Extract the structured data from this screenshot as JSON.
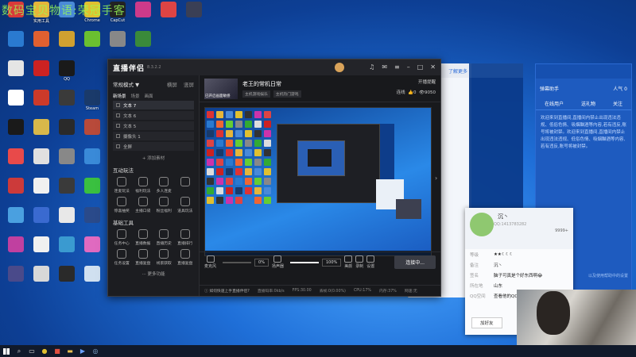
{
  "watermark": "数码宝贝物语:荣冠手客",
  "desktop_icons": [
    {
      "label": "",
      "color": "#d83a3a",
      "col": 0,
      "row": 0
    },
    {
      "label": "实用工具",
      "color": "#e5b53a",
      "col": 1,
      "row": 0
    },
    {
      "label": "",
      "color": "#4a8ad8",
      "col": 2,
      "row": 0
    },
    {
      "label": "Chrome",
      "color": "#e0c030",
      "col": 3,
      "row": 0
    },
    {
      "label": "CapCut",
      "color": "#222222",
      "col": 4,
      "row": 0
    },
    {
      "label": "",
      "color": "#cc3a8a",
      "col": 5,
      "row": 0
    },
    {
      "label": "",
      "color": "#dd4444",
      "col": 6,
      "row": 0
    },
    {
      "label": "",
      "color": "#3a3f55",
      "col": 7,
      "row": 0
    },
    {
      "label": "",
      "color": "#2a7ad0",
      "col": 0,
      "row": 1
    },
    {
      "label": "",
      "color": "#e06030",
      "col": 1,
      "row": 1
    },
    {
      "label": "",
      "color": "#d0a030",
      "col": 2,
      "row": 1
    },
    {
      "label": "",
      "color": "#6ac030",
      "col": 3,
      "row": 1
    },
    {
      "label": "",
      "color": "#888888",
      "col": 4,
      "row": 1
    },
    {
      "label": "",
      "color": "#3a8a3a",
      "col": 5,
      "row": 1
    },
    {
      "label": "",
      "color": "#e5e5e5",
      "col": 0,
      "row": 2
    },
    {
      "label": "",
      "color": "#cc2222",
      "col": 1,
      "row": 2
    },
    {
      "label": "QQ",
      "color": "#1a1a1a",
      "col": 2,
      "row": 2
    },
    {
      "label": "",
      "color": "#ffffff",
      "col": 0,
      "row": 3
    },
    {
      "label": "",
      "color": "#cc3a2a",
      "col": 1,
      "row": 3
    },
    {
      "label": "",
      "color": "#3a3a3a",
      "col": 2,
      "row": 3
    },
    {
      "label": "Steam",
      "color": "#1a3a6a",
      "col": 3,
      "row": 3
    },
    {
      "label": "",
      "color": "#1a1a1a",
      "col": 0,
      "row": 4
    },
    {
      "label": "",
      "color": "#d8b84a",
      "col": 1,
      "row": 4
    },
    {
      "label": "",
      "color": "#2a2a2a",
      "col": 2,
      "row": 4
    },
    {
      "label": "",
      "color": "#b84a3a",
      "col": 3,
      "row": 4
    },
    {
      "label": "",
      "color": "#e84a4a",
      "col": 0,
      "row": 5
    },
    {
      "label": "",
      "color": "#e0e0e0",
      "col": 1,
      "row": 5
    },
    {
      "label": "",
      "color": "#888888",
      "col": 2,
      "row": 5
    },
    {
      "label": "",
      "color": "#3a8ad8",
      "col": 3,
      "row": 5
    },
    {
      "label": "",
      "color": "#cc3a3a",
      "col": 0,
      "row": 6
    },
    {
      "label": "",
      "color": "#f0f0f0",
      "col": 1,
      "row": 6
    },
    {
      "label": "",
      "color": "#3a3a3a",
      "col": 2,
      "row": 6
    },
    {
      "label": "",
      "color": "#3ac040",
      "col": 3,
      "row": 6
    },
    {
      "label": "",
      "color": "#4aa0e0",
      "col": 0,
      "row": 7
    },
    {
      "label": "",
      "color": "#3a6ad0",
      "col": 1,
      "row": 7
    },
    {
      "label": "",
      "color": "#e8e8e8",
      "col": 2,
      "row": 7
    },
    {
      "label": "",
      "color": "#2a4a8a",
      "col": 3,
      "row": 7
    },
    {
      "label": "",
      "color": "#c040a0",
      "col": 0,
      "row": 8
    },
    {
      "label": "",
      "color": "#f0f0f0",
      "col": 1,
      "row": 8
    },
    {
      "label": "",
      "color": "#3a9ad0",
      "col": 2,
      "row": 8
    },
    {
      "label": "",
      "color": "#e06ac0",
      "col": 3,
      "row": 8
    },
    {
      "label": "",
      "color": "#4a4a8a",
      "col": 0,
      "row": 9
    },
    {
      "label": "",
      "color": "#d8d8d8",
      "col": 1,
      "row": 9
    },
    {
      "label": "",
      "color": "#2a2a2a",
      "col": 2,
      "row": 9
    },
    {
      "label": "",
      "color": "#d0e0f0",
      "col": 3,
      "row": 9
    }
  ],
  "app": {
    "brand": "直播伴侣",
    "version": "8.3.2.2",
    "left": {
      "scene_label": "常规模式 ▼",
      "mode_a": "横屏",
      "mode_b": "竖屏",
      "tabs": [
        "新场景",
        "场景",
        "画面"
      ],
      "sources": [
        "文本 7",
        "文本 6",
        "文本 5",
        "摄像头 1",
        "全屏"
      ],
      "add_source": "+ 添加素材",
      "interactive_title": "互动玩法",
      "interactive_tools": [
        "连麦玩法",
        "福利玩法",
        "多人连麦",
        "",
        "惊喜抽奖",
        "主播口袋",
        "粉丝福利",
        "道具玩法"
      ],
      "basic_title": "基础工具",
      "basic_tools": [
        "任务中心",
        "直播数据",
        "直播历史",
        "直播排行",
        "任务设置",
        "直播复盘",
        "线索获取",
        "直播复盘"
      ],
      "more": "··· 更多功能"
    },
    "stream": {
      "thumb_caption": "已开启画面敏感",
      "title": "老王的常机日常",
      "tags": [
        "主机游戏娱乐",
        "主机热门游戏"
      ],
      "prompt": "开播提醒",
      "like_count": "0",
      "view_count": "9050",
      "co_label": "连线"
    },
    "controls": {
      "mic_label": "麦克风",
      "mic_pct": "0%",
      "speaker_label": "扬声器",
      "speaker_pct": "100%",
      "beauty": "美颜",
      "record": "录制",
      "settings": "设置",
      "live_button": "连接中..."
    },
    "status": {
      "warning": "ⓘ 如何快速上手直播伴侣?",
      "bitrate": "直播码率:0kb/s",
      "fps": "FPS:30.00",
      "drop": "丢帧:0(0.00%)",
      "cpu": "CPU:17%",
      "mem": "内存:37%",
      "net": "网速:无"
    }
  },
  "assistant": {
    "title": "弹幕助手",
    "online_label": "人气",
    "online_count": "0",
    "tabs": [
      "在线用户",
      "送礼物",
      "关注"
    ],
    "body": "欢迎来到直播间,直播间内禁止出现违法违规、低俗色情、吸烟酗酒等内容,若有违反,账号将被封禁。欢迎来到直播间,直播间内禁止出现违法违规、低俗色情、吸烟酗酒等内容,若有违反,账号将被封禁。",
    "footer": "以及使用帮助中的设置"
  },
  "background_window": {
    "title_link": "了解更多"
  },
  "profile": {
    "name": "沉丶",
    "qq": "QQ:1413783282",
    "vip": "9999+",
    "rows": [
      {
        "k": "等级",
        "v": "★★☾☾☾"
      },
      {
        "k": "备注",
        "v": "沉丶"
      },
      {
        "k": "签名",
        "v": "脑子可真是个好东西啊😂"
      },
      {
        "k": "所在地",
        "v": "山东"
      },
      {
        "k": "QQ空间",
        "v": "查看他的QQ空间"
      }
    ],
    "add_button": "加好友"
  },
  "taskbar": {
    "items": [
      "start",
      "search",
      "task",
      "chrome",
      "app",
      "folder",
      "live",
      "steam"
    ]
  }
}
